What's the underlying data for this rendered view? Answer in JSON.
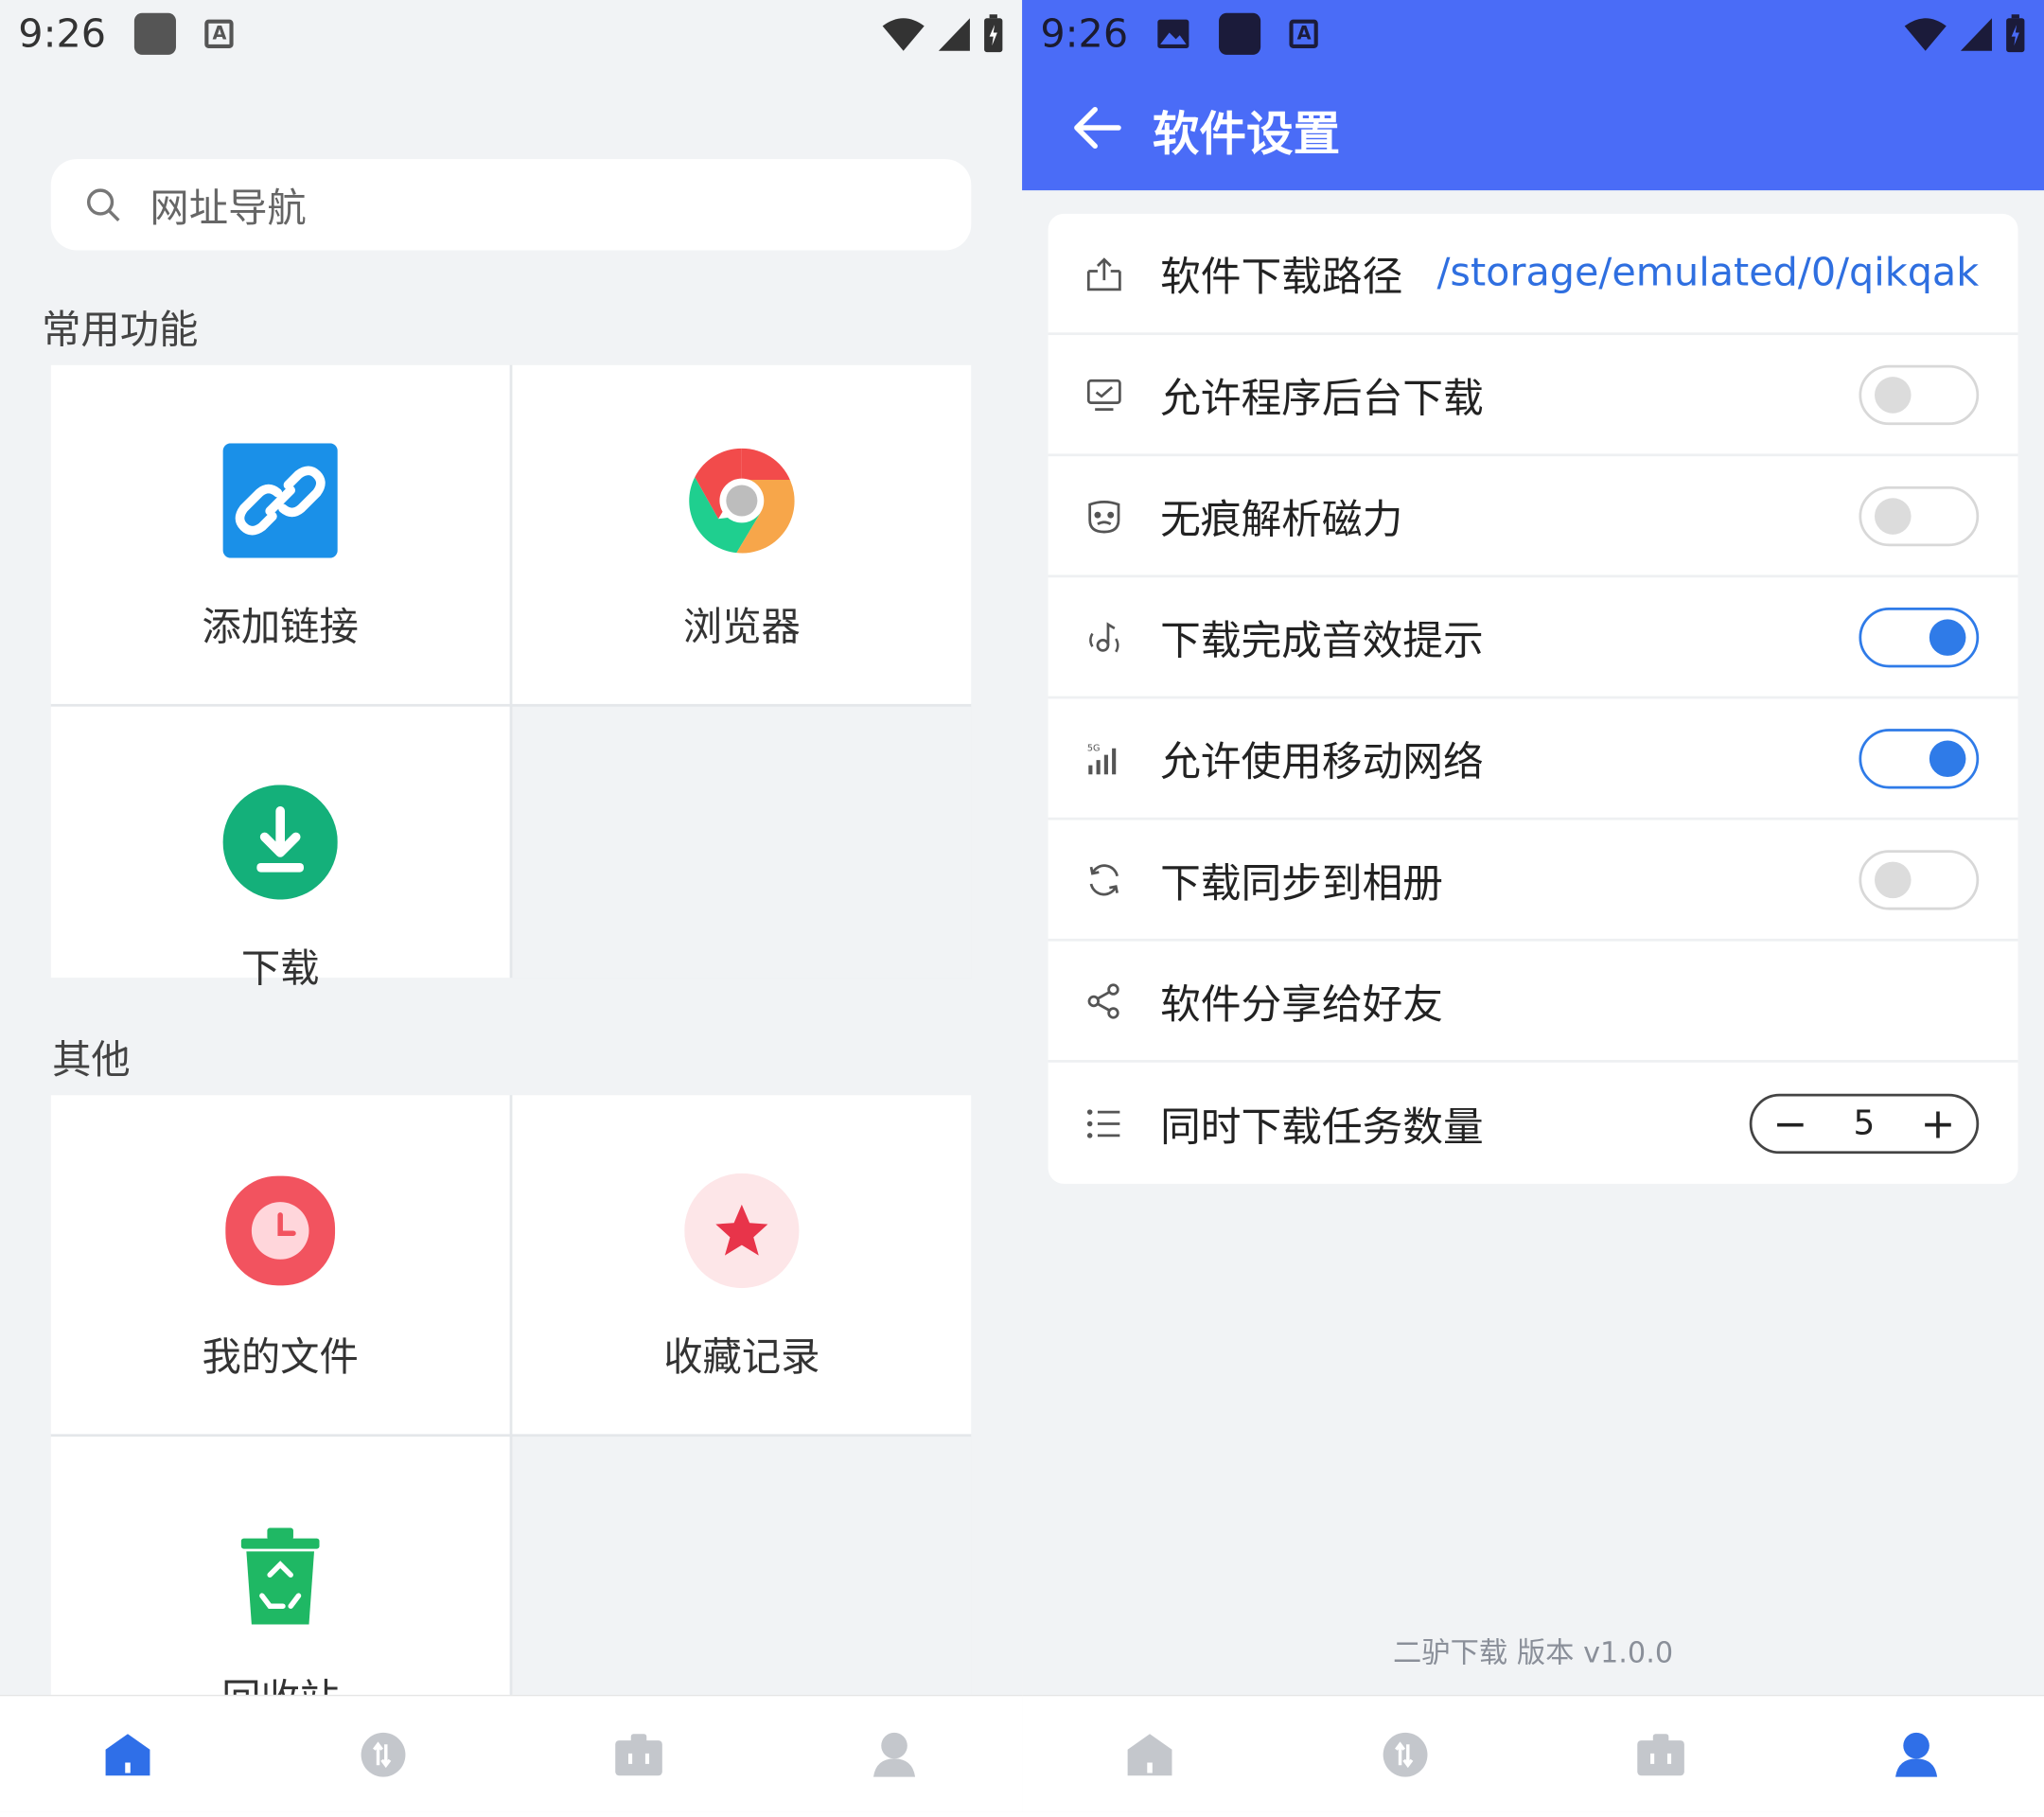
{
  "left": {
    "status": {
      "time": "9:26"
    },
    "search": {
      "placeholder": "网址导航"
    },
    "sections": {
      "common_title": "常用功能",
      "other_title": "其他"
    },
    "common": {
      "add_link": "添加链接",
      "browser": "浏览器",
      "download": "下载"
    },
    "other": {
      "my_files": "我的文件",
      "favorites": "收藏记录",
      "recycle": "回收站"
    }
  },
  "right": {
    "status": {
      "time": "9:26"
    },
    "appbar": {
      "title": "软件设置"
    },
    "settings": {
      "download_path": {
        "label": "软件下载路径",
        "value": "/storage/emulated/0/qikqak"
      },
      "background_download": {
        "label": "允许程序后台下载",
        "enabled": false
      },
      "incognito_magnet": {
        "label": "无痕解析磁力",
        "enabled": false
      },
      "sound_on_complete": {
        "label": "下载完成音效提示",
        "enabled": true
      },
      "mobile_network": {
        "label": "允许使用移动网络",
        "enabled": true
      },
      "sync_to_album": {
        "label": "下载同步到相册",
        "enabled": false
      },
      "share_app": {
        "label": "软件分享给好友"
      },
      "concurrent_tasks": {
        "label": "同时下载任务数量",
        "value": "5"
      }
    },
    "version": "二驴下载 版本 v1.0.0"
  },
  "colors": {
    "accent": "#4a6cf7",
    "toggle_on": "#2f7be8",
    "path_text": "#2f6fe0",
    "download_green": "#14b07a",
    "favorite_red": "#e8344a"
  }
}
